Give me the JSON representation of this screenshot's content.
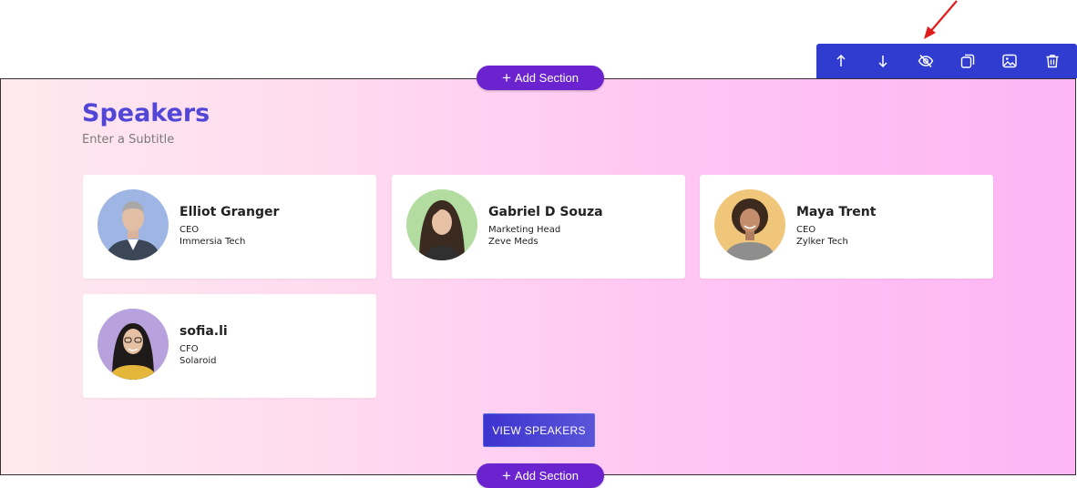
{
  "toolbar": {
    "buttons": [
      {
        "icon": "arrow-up-icon"
      },
      {
        "icon": "arrow-down-icon"
      },
      {
        "icon": "eye-off-icon"
      },
      {
        "icon": "duplicate-icon"
      },
      {
        "icon": "image-icon"
      },
      {
        "icon": "trash-icon"
      }
    ],
    "color": "#2f3ccf"
  },
  "add_section": {
    "label": "Add Section"
  },
  "speakers": {
    "title": "Speakers",
    "subtitle": "Enter a Subtitle",
    "items": [
      {
        "name": "Elliot Granger",
        "role": "CEO",
        "company": "Immersia Tech",
        "avatar_bg": "#9fb6e4"
      },
      {
        "name": "Gabriel D Souza",
        "role": "Marketing Head",
        "company": "Zeve Meds",
        "avatar_bg": "#b3dca0"
      },
      {
        "name": "Maya Trent",
        "role": "CEO",
        "company": "Zylker Tech",
        "avatar_bg": "#f0c77a"
      },
      {
        "name": "sofia.li",
        "role": "CFO",
        "company": "Solaroid",
        "avatar_bg": "#b8a2de"
      }
    ],
    "view_button": "VIEW SPEAKERS"
  },
  "colors": {
    "accent": "#5246d6",
    "add_section_bg": "#6b23cf",
    "annotation_arrow": "#e01b1b"
  }
}
